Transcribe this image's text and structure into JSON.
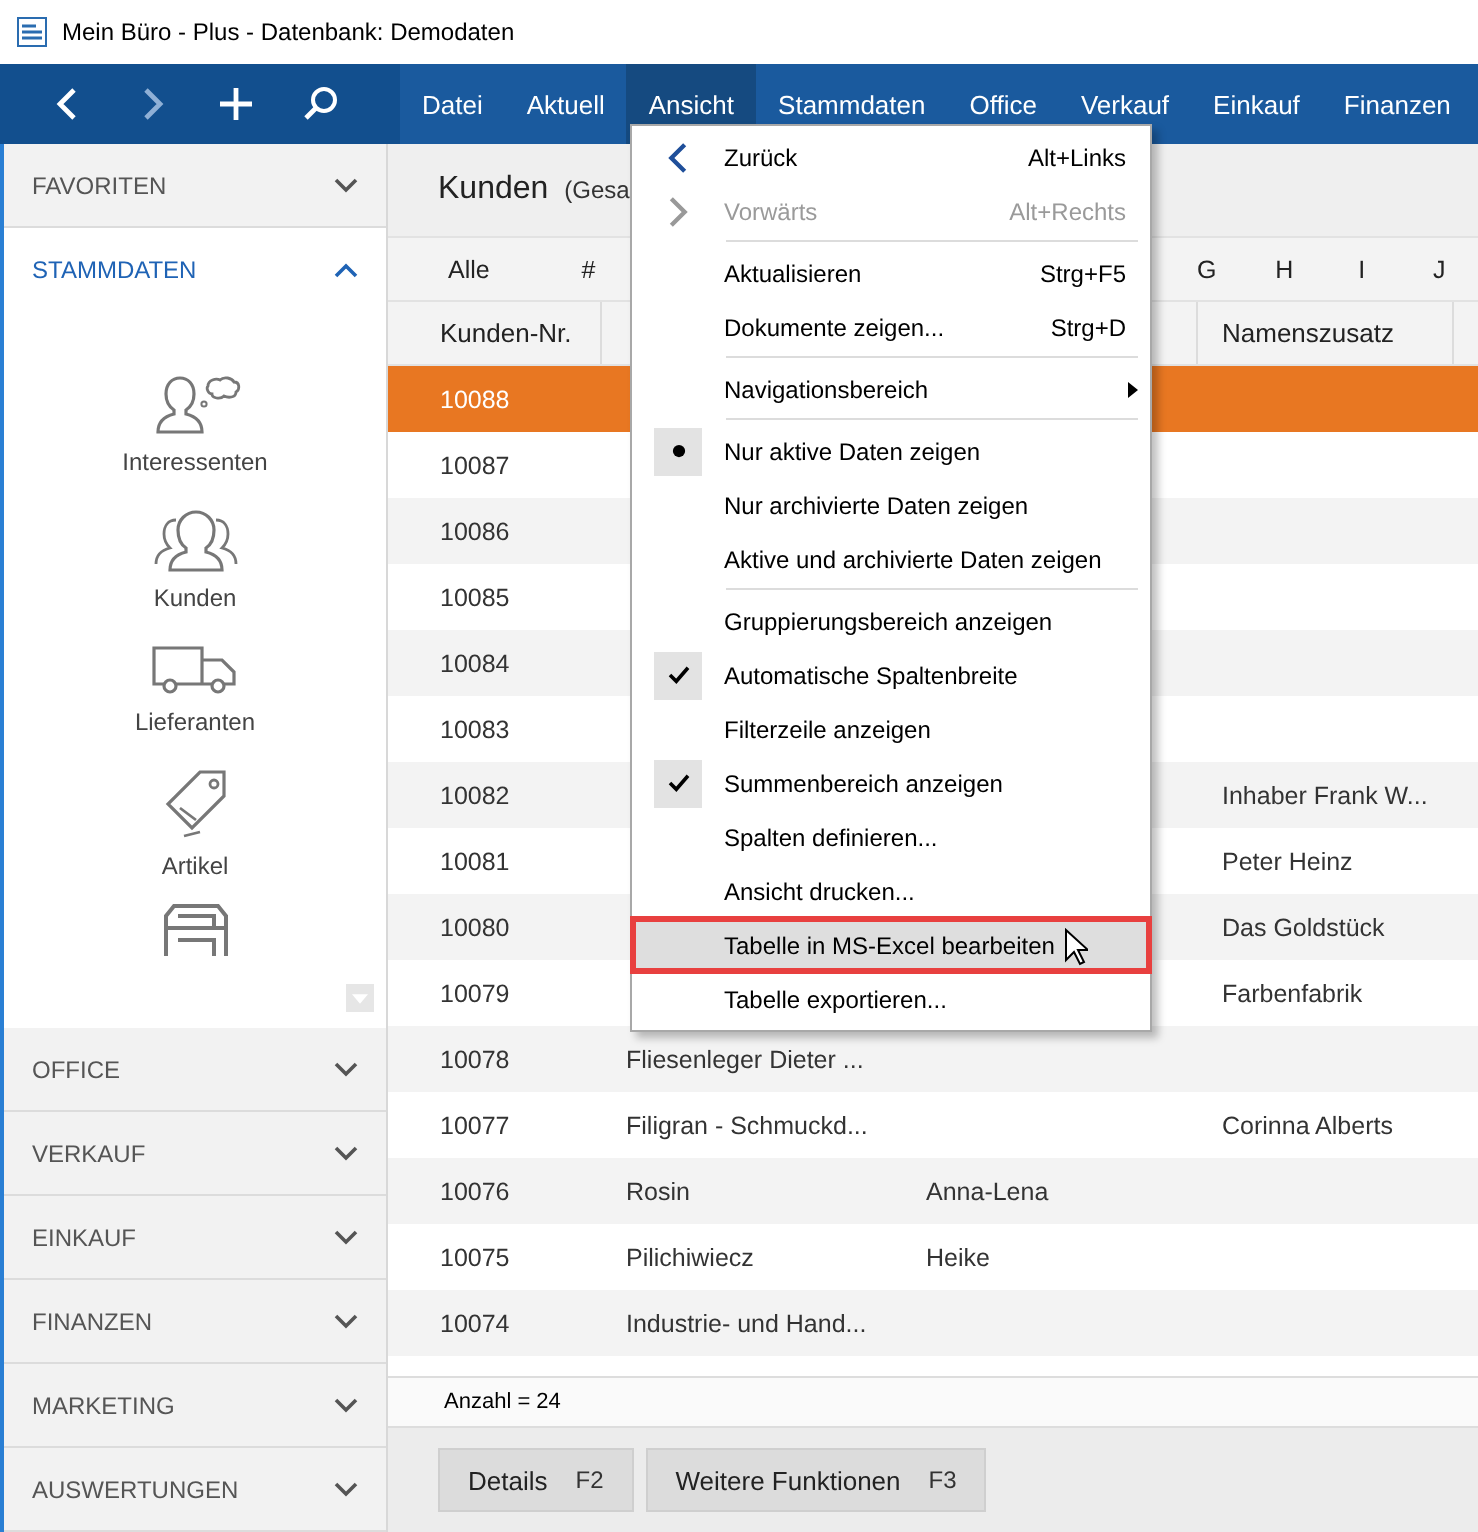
{
  "window": {
    "title": "Mein Büro - Plus - Datenbank: Demodaten"
  },
  "toolbar": [
    {
      "kind": "back",
      "disabled": false
    },
    {
      "kind": "forward",
      "disabled": true
    },
    {
      "kind": "add",
      "disabled": false
    },
    {
      "kind": "search",
      "disabled": false
    }
  ],
  "menubar": [
    {
      "label": "Datei",
      "selected": false
    },
    {
      "label": "Aktuell",
      "selected": false
    },
    {
      "label": "Ansicht",
      "selected": true
    },
    {
      "label": "Stammdaten",
      "selected": false
    },
    {
      "label": "Office",
      "selected": false
    },
    {
      "label": "Verkauf",
      "selected": false
    },
    {
      "label": "Einkauf",
      "selected": false
    },
    {
      "label": "Finanzen",
      "selected": false
    }
  ],
  "sidebar": {
    "top_sections": [
      {
        "label": "FAVORITEN",
        "expanded": false
      },
      {
        "label": "STAMMDATEN",
        "expanded": true
      }
    ],
    "items": [
      {
        "kind": "prospects",
        "label": "Interessenten"
      },
      {
        "kind": "customers",
        "label": "Kunden"
      },
      {
        "kind": "suppliers",
        "label": "Lieferanten"
      },
      {
        "kind": "articles",
        "label": "Artikel"
      },
      {
        "kind": "archive"
      }
    ],
    "bottom_sections": [
      {
        "label": "OFFICE",
        "expanded": false
      },
      {
        "label": "VERKAUF",
        "expanded": false
      },
      {
        "label": "EINKAUF",
        "expanded": false
      },
      {
        "label": "FINANZEN",
        "expanded": false
      },
      {
        "label": "MARKETING",
        "expanded": false
      },
      {
        "label": "AUSWERTUNGEN",
        "expanded": false
      }
    ]
  },
  "header": {
    "title": "Kunden",
    "subtitle": "(Gesa"
  },
  "alphabet": {
    "left": [
      {
        "label": "Alle"
      },
      {
        "label": "#"
      }
    ],
    "right": [
      {
        "label": "G"
      },
      {
        "label": "H"
      },
      {
        "label": "I"
      },
      {
        "label": "J"
      }
    ]
  },
  "table": {
    "columns": [
      "Kunden-Nr.",
      "Namenszusatz"
    ],
    "rows": [
      {
        "number": "10088",
        "selected": true
      },
      {
        "number": "10087",
        "selected": false
      },
      {
        "number": "10086",
        "selected": false
      },
      {
        "number": "10085",
        "selected": false
      },
      {
        "number": "10084",
        "selected": false
      },
      {
        "number": "10083",
        "selected": false
      },
      {
        "number": "10082",
        "selected": false,
        "suffix": "Inhaber Frank W..."
      },
      {
        "number": "10081",
        "selected": false,
        "suffix": "Peter Heinz"
      },
      {
        "number": "10080",
        "selected": false,
        "suffix": "Das Goldstück"
      },
      {
        "number": "10079",
        "selected": false,
        "suffix": "Farbenfabrik"
      },
      {
        "number": "10078",
        "selected": false,
        "name": "Fliesenleger Dieter ..."
      },
      {
        "number": "10077",
        "selected": false,
        "name": "Filigran - Schmuckd...",
        "suffix": "Corinna Alberts"
      },
      {
        "number": "10076",
        "selected": false,
        "name": "Rosin",
        "first_name": "Anna-Lena"
      },
      {
        "number": "10075",
        "selected": false,
        "name": "Pilichiwiecz",
        "first_name": "Heike"
      },
      {
        "number": "10074",
        "selected": false,
        "name": "Industrie- und Hand..."
      }
    ]
  },
  "summary": "Anzahl = 24",
  "buttons": [
    {
      "label": "Details",
      "key": "F2"
    },
    {
      "label": "Weitere Funktionen",
      "key": "F3"
    }
  ],
  "menu": {
    "groups": [
      [
        {
          "kind": "back",
          "label": "Zurück",
          "shortcut": "Alt+Links",
          "disabled": false,
          "selected": false
        },
        {
          "kind": "forward",
          "label": "Vorwärts",
          "shortcut": "Alt+Rechts",
          "disabled": true,
          "selected": false
        }
      ],
      [
        {
          "kind": "command",
          "label": "Aktualisieren",
          "shortcut": "Strg+F5",
          "disabled": false,
          "selected": false
        },
        {
          "kind": "command",
          "label": "Dokumente zeigen...",
          "shortcut": "Strg+D",
          "disabled": false,
          "selected": false
        }
      ],
      [
        {
          "kind": "submenu",
          "label": "Navigationsbereich",
          "disabled": false,
          "selected": false
        }
      ],
      [
        {
          "kind": "radio",
          "label": "Nur aktive Daten zeigen",
          "checked": true,
          "disabled": false,
          "selected": false
        },
        {
          "kind": "radio",
          "label": "Nur archivierte Daten zeigen",
          "checked": false,
          "disabled": false,
          "selected": false
        },
        {
          "kind": "radio",
          "label": "Aktive und archivierte Daten zeigen",
          "checked": false,
          "disabled": false,
          "selected": false
        }
      ],
      [
        {
          "kind": "check",
          "label": "Gruppierungsbereich anzeigen",
          "checked": false,
          "disabled": false,
          "selected": false
        },
        {
          "kind": "check",
          "label": "Automatische Spaltenbreite",
          "checked": true,
          "disabled": false,
          "selected": false
        },
        {
          "kind": "check",
          "label": "Filterzeile anzeigen",
          "checked": false,
          "disabled": false,
          "selected": false
        },
        {
          "kind": "check",
          "label": "Summenbereich anzeigen",
          "checked": true,
          "disabled": false,
          "selected": false
        },
        {
          "kind": "command",
          "label": "Spalten definieren...",
          "disabled": false,
          "selected": false
        },
        {
          "kind": "command",
          "label": "Ansicht drucken...",
          "disabled": false,
          "selected": false
        },
        {
          "kind": "command",
          "label": "Tabelle in MS-Excel bearbeiten",
          "disabled": false,
          "selected": true
        },
        {
          "kind": "command",
          "label": "Tabelle exportieren...",
          "disabled": false,
          "selected": false
        }
      ]
    ]
  }
}
